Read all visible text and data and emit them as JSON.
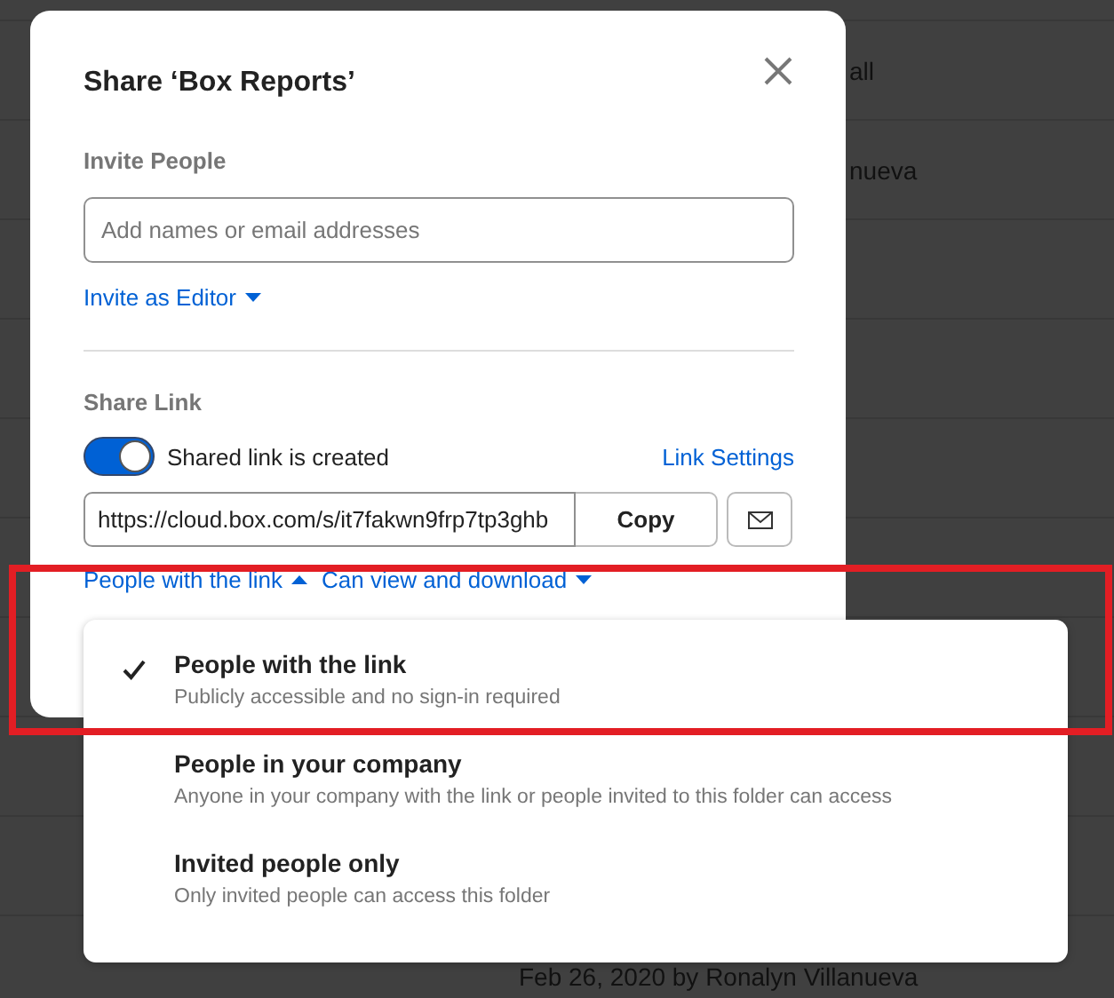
{
  "background": {
    "rows": [
      {
        "cell": "all"
      },
      {
        "cell": "nueva"
      },
      {
        "cell": "Feb 26, 2020 by Ronalyn Villanueva"
      }
    ]
  },
  "dialog": {
    "title": "Share ‘Box Reports’",
    "invite": {
      "heading": "Invite People",
      "placeholder": "Add names or email addresses",
      "role_link": "Invite as Editor",
      "role_expanded": false
    },
    "share_link": {
      "heading": "Share Link",
      "toggle": {
        "label": "Shared link is created",
        "on": true
      },
      "settings_link": "Link Settings",
      "url": "https://cloud.box.com/s/it7fakwn9frp7tp3ghb",
      "copy_button": "Copy",
      "access_link": {
        "label": "People with the link",
        "expanded": true
      },
      "permission_link": {
        "label": "Can view and download",
        "expanded": false
      }
    }
  },
  "access_menu": {
    "items": [
      {
        "title": "People with the link",
        "description": "Publicly accessible and no sign-in required",
        "selected": true
      },
      {
        "title": "People in your company",
        "description": "Anyone in your company with the link or people invited to this folder can access",
        "selected": false
      },
      {
        "title": "Invited people only",
        "description": "Only invited people can access this folder",
        "selected": false
      }
    ]
  },
  "annotation": {
    "kind": "highlight-box"
  }
}
